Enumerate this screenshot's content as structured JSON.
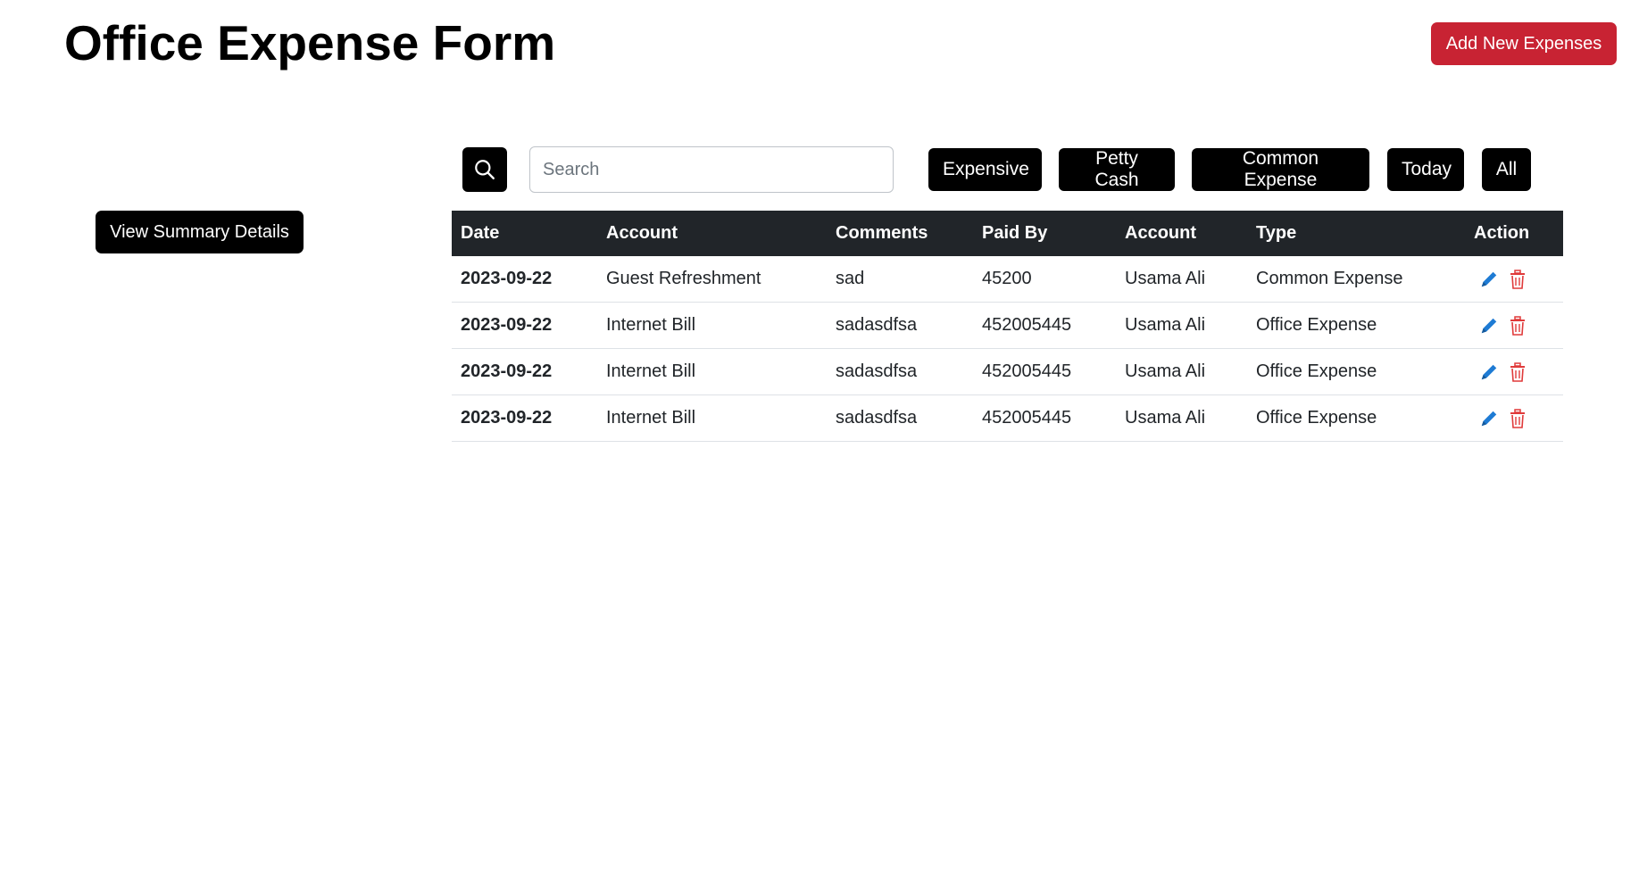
{
  "header": {
    "title": "Office Expense Form",
    "add_button_label": "Add New Expenses"
  },
  "sidebar": {
    "summary_button_label": "View Summary Details"
  },
  "search": {
    "placeholder": "Search",
    "value": ""
  },
  "filters": [
    {
      "label": "Expensive"
    },
    {
      "label": "Petty Cash"
    },
    {
      "label": "Common Expense"
    },
    {
      "label": "Today"
    },
    {
      "label": "All"
    }
  ],
  "table": {
    "columns": [
      "Date",
      "Account",
      "Comments",
      "Paid By",
      "Account",
      "Type",
      "Action"
    ],
    "rows": [
      {
        "date": "2023-09-22",
        "account": "Guest Refreshment",
        "comments": "sad",
        "paid_by": "45200",
        "account2": "Usama Ali",
        "type": "Common Expense"
      },
      {
        "date": "2023-09-22",
        "account": "Internet Bill",
        "comments": "sadasdfsa",
        "paid_by": "452005445",
        "account2": "Usama Ali",
        "type": "Office Expense"
      },
      {
        "date": "2023-09-22",
        "account": "Internet Bill",
        "comments": "sadasdfsa",
        "paid_by": "452005445",
        "account2": "Usama Ali",
        "type": "Office Expense"
      },
      {
        "date": "2023-09-22",
        "account": "Internet Bill",
        "comments": "sadasdfsa",
        "paid_by": "452005445",
        "account2": "Usama Ali",
        "type": "Office Expense"
      }
    ],
    "row_actions": [
      {
        "icon": "pencil-icon",
        "color": "#1e7bd4"
      },
      {
        "icon": "trash-icon",
        "color": "#e03a3a"
      }
    ]
  },
  "colors": {
    "accent_red": "#c82333",
    "dark": "#000000",
    "table_header": "#212529"
  }
}
